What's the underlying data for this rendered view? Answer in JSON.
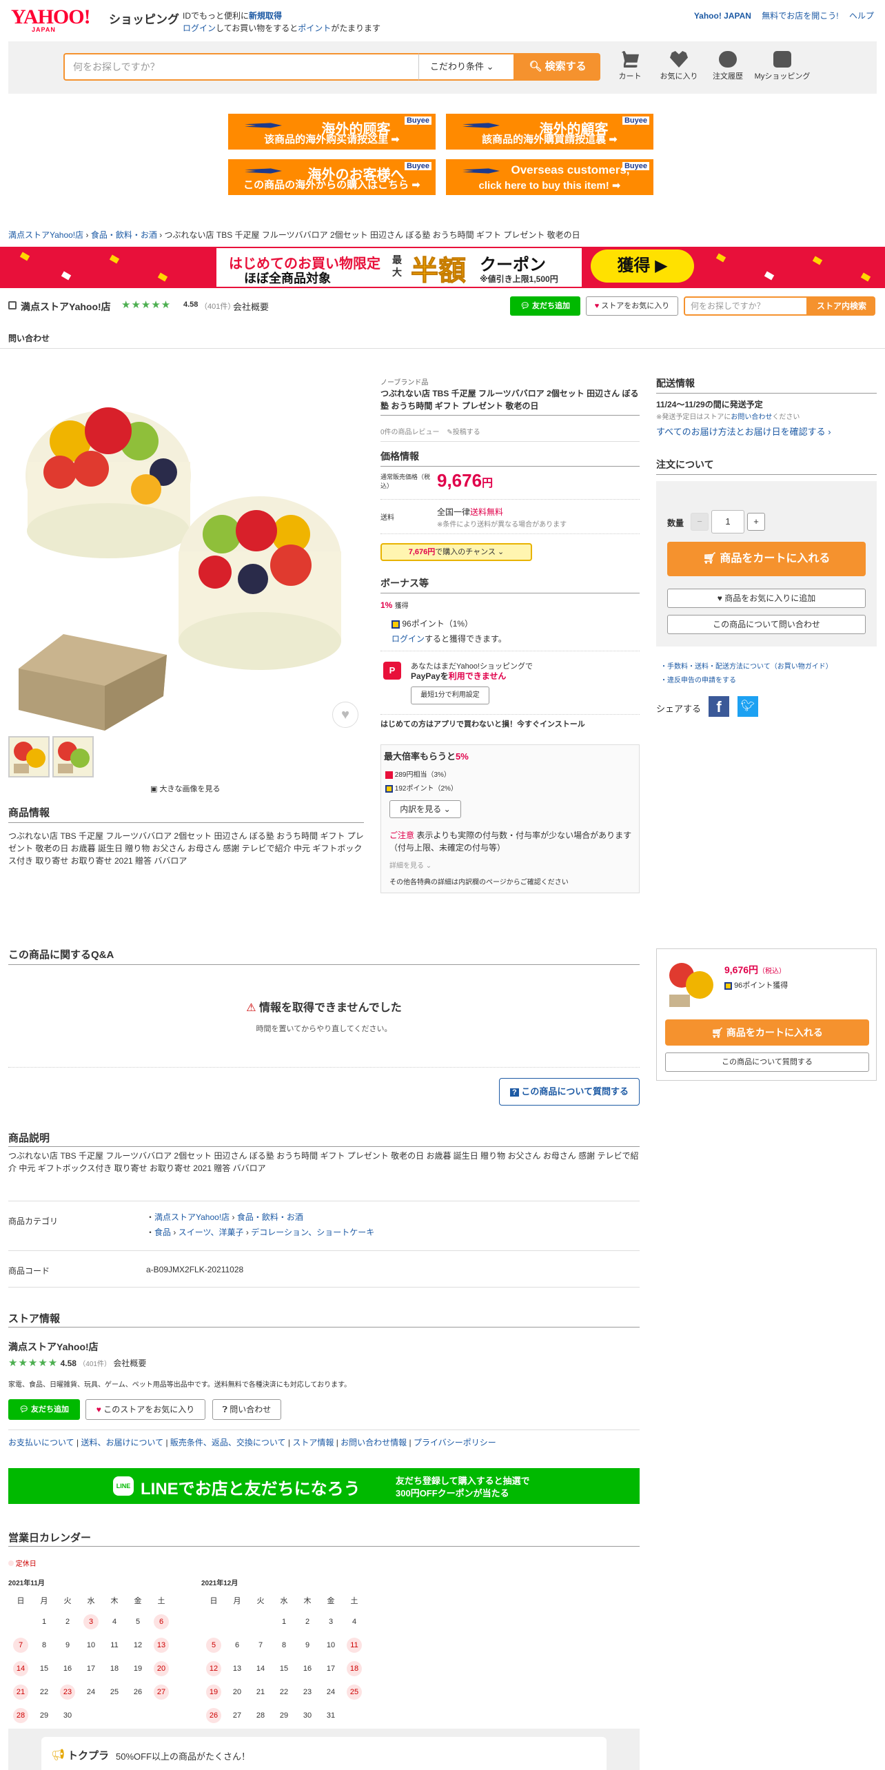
{
  "header": {
    "logo": "YAHOO!",
    "logo_sub": "JAPAN",
    "service": "ショッピング",
    "promo_line1_prefix": "IDでもっと便利に",
    "promo_line1_link": "新規取得",
    "promo_line2_link1": "ログイン",
    "promo_line2_mid": "してお買い物をすると",
    "promo_line2_link2": "ポイント",
    "promo_line2_suffix": "がたまります",
    "top_links": [
      "Yahoo! JAPAN",
      "無料でお店を開こう!",
      "ヘルプ"
    ]
  },
  "search": {
    "placeholder": "何をお探しですか？",
    "filter_label": "こだわり条件",
    "button": "検索する"
  },
  "header_icons": [
    {
      "label": "カート",
      "icon": "cart-icon"
    },
    {
      "label": "お気に入り",
      "icon": "heart-icon"
    },
    {
      "label": "注文履歴",
      "icon": "yen-history-icon"
    },
    {
      "label": "Myショッピング",
      "icon": "user-icon"
    }
  ],
  "banners": [
    {
      "title": "海外的顾客",
      "sub": "该商品的海外购买请按这里 ➡",
      "brand": "Buyee"
    },
    {
      "title": "海外的顧客",
      "sub": "該商品的海外購買請按這裏 ➡",
      "brand": "Buyee"
    },
    {
      "title": "海外のお客様へ",
      "sub": "この商品の海外からの購入はこちら ➡",
      "brand": "Buyee"
    },
    {
      "title": "Overseas customers,",
      "sub": "click here to buy this item! ➡",
      "brand": "Buyee"
    }
  ],
  "breadcrumb": [
    "満点ストアYahoo!店",
    "食品・飲料・お酒",
    "つぶれない店 TBS 千疋屋 フルーツババロア 2個セット 田辺さん ぼる塾 おうち時間 ギフト プレゼント 敬老の日"
  ],
  "coupon": {
    "line1": "はじめてのお買い物限定",
    "line2": "ほぼ全商品対象",
    "max": "最大",
    "half": "半額",
    "word": "クーポン",
    "note": "※値引き上限1,500円",
    "button": "獲得 ▶"
  },
  "store": {
    "name": "満点ストアYahoo!店",
    "stars": "★★★★★",
    "rating": "4.58",
    "reviews": "（401件）",
    "overview": "会社概要",
    "line_btn": "友だち追加",
    "fav_btn": "ストアをお気に入り",
    "search_placeholder": "何をお探しですか？",
    "search_btn": "ストア内検索",
    "inquiry": "問い合わせ"
  },
  "product": {
    "brand": "ノーブランド品",
    "title": "つぶれない店 TBS 千疋屋 フルーツババロア 2個セット 田辺さん ぼる塾 おうち時間 ギフト プレゼント 敬老の日",
    "reviews": "0件の商品レビュー",
    "post": "投稿する",
    "price_header": "価格情報",
    "price_label": "通常販売価格（税込）",
    "price": "9,676",
    "yen": "円",
    "shipping_label": "送料",
    "shipping_text": "全国一律",
    "shipping_free": "送料無料",
    "shipping_note": "※条件により送料が異なる場合があります",
    "chance_price": "7,676円",
    "chance_text": "で購入のチャンス",
    "bonus_header": "ボーナス等",
    "bonus_rate": "1%",
    "bonus_get": "獲得",
    "points": "96ポイント（1%）",
    "login": "ログイン",
    "login_suffix": "すると獲得できます。",
    "paypay1": "あなたはまだYahoo!ショッピングで",
    "paypay2_prefix": "PayPayを",
    "paypay2_red": "利用できません",
    "paypay_btn": "最短1分で利用設定",
    "app": "はじめての方はアプリで買わないと損！今すぐインストール",
    "max_header": "最大倍率もらうと",
    "max_rate": "5%",
    "pp": "289円相当（3%）",
    "tp": "192ポイント（2%）",
    "breakdown": "内訳を見る",
    "caution_label": "ご注意",
    "caution": "表示よりも実際の付与数・付与率が少ない場合があります（付与上限、未確定の付与等）",
    "detail": "詳細を見る",
    "other": "その他各特典の詳細は内訳欄のページからご確認ください",
    "large_image": "大きな画像を見る"
  },
  "item_info": {
    "header": "商品情報",
    "text": "つぶれない店 TBS 千疋屋 フルーツババロア 2個セット 田辺さん ぼる塾 おうち時間 ギフト プレゼント 敬老の日 お歳暮 誕生日 贈り物 お父さん お母さん 感謝 テレビで紹介 中元 ギフトボックス付き 取り寄せ お取り寄せ 2021 贈答 ババロア"
  },
  "delivery": {
    "header": "配送情報",
    "date": "11/24〜11/29の間に発送予定",
    "note_prefix": "※発送予定日はストアに",
    "note_link": "お問い合わせ",
    "note_suffix": "ください",
    "all": "すべてのお届け方法とお届け日を確認する"
  },
  "order": {
    "header": "注文について",
    "qty_label": "数量",
    "qty": "1",
    "cart": "商品をカートに入れる",
    "fav": "商品をお気に入りに追加",
    "inquiry": "この商品について問い合わせ",
    "guide": "手数料・送料・配送方法について（お買い物ガイド）",
    "report": "違反申告の申請をする",
    "share": "シェアする"
  },
  "qa": {
    "header": "この商品に関するQ&A",
    "error": "情報を取得できませんでした",
    "retry": "時間を置いてからやり直してください。",
    "ask": "この商品について質問する"
  },
  "sticky": {
    "price": "9,676円",
    "tax": "（税込）",
    "points": "96ポイント獲得",
    "cart": "商品をカートに入れる",
    "ask": "この商品について質問する"
  },
  "desc": {
    "header": "商品説明",
    "text": "つぶれない店 TBS 千疋屋 フルーツババロア 2個セット 田辺さん ぼる塾 おうち時間 ギフト プレゼント 敬老の日 お歳暮 誕生日 贈り物 お父さん お母さん 感謝 テレビで紹介 中元 ギフトボックス付き 取り寄せ お取り寄せ 2021 贈答 ババロア",
    "cat_label": "商品カテゴリ",
    "cat1a": "満点ストアYahoo!店",
    "cat1b": "食品・飲料・お酒",
    "cat2a": "食品",
    "cat2b": "スイーツ、洋菓子",
    "cat2c": "デコレーション、ショートケーキ",
    "code_label": "商品コード",
    "code": "a-B09JMX2FLK-20211028"
  },
  "store_info": {
    "header": "ストア情報",
    "name": "満点ストアYahoo!店",
    "rating": "4.58",
    "reviews": "（401件）",
    "overview": "会社概要",
    "desc": "家電、食品、日曜雑貨、玩具、ゲーム、ペット用品等出品中です。送料無料で各種決済にも対応しております。",
    "line": "友だち追加",
    "fav": "このストアをお気に入り",
    "inquiry": "問い合わせ",
    "links": [
      "お支払いについて",
      "送料、お届けについて",
      "販売条件、返品、交換について",
      "ストア情報",
      "お問い合わせ情報",
      "プライバシーポリシー"
    ]
  },
  "line_banner": {
    "main": "LINEでお店と友だちになろう",
    "sub1": "友だち登録して購入すると抽選で",
    "sub2": "300円OFFクーポンが当たる"
  },
  "calendar": {
    "header": "営業日カレンダー",
    "legend": "定休日",
    "weekdays": [
      "日",
      "月",
      "火",
      "水",
      "木",
      "金",
      "土"
    ],
    "months": [
      {
        "title": "2021年11月",
        "weeks": [
          [
            "",
            "1",
            "2",
            "3",
            "4",
            "5",
            "6"
          ],
          [
            "7",
            "8",
            "9",
            "10",
            "11",
            "12",
            "13"
          ],
          [
            "14",
            "15",
            "16",
            "17",
            "18",
            "19",
            "20"
          ],
          [
            "21",
            "22",
            "23",
            "24",
            "25",
            "26",
            "27"
          ],
          [
            "28",
            "29",
            "30",
            "",
            "",
            "",
            ""
          ]
        ],
        "holidays": [
          "3",
          "6",
          "7",
          "13",
          "14",
          "20",
          "21",
          "23",
          "27",
          "28"
        ]
      },
      {
        "title": "2021年12月",
        "weeks": [
          [
            "",
            "",
            "",
            "1",
            "2",
            "3",
            "4"
          ],
          [
            "5",
            "6",
            "7",
            "8",
            "9",
            "10",
            "11"
          ],
          [
            "12",
            "13",
            "14",
            "15",
            "16",
            "17",
            "18"
          ],
          [
            "19",
            "20",
            "21",
            "22",
            "23",
            "24",
            "25"
          ],
          [
            "26",
            "27",
            "28",
            "29",
            "30",
            "31",
            ""
          ]
        ],
        "holidays": [
          "5",
          "11",
          "12",
          "18",
          "19",
          "25",
          "26"
        ]
      }
    ]
  },
  "tokupura": {
    "brand": "トクプラ",
    "text": "50%OFF以上の商品がたくさん！"
  }
}
